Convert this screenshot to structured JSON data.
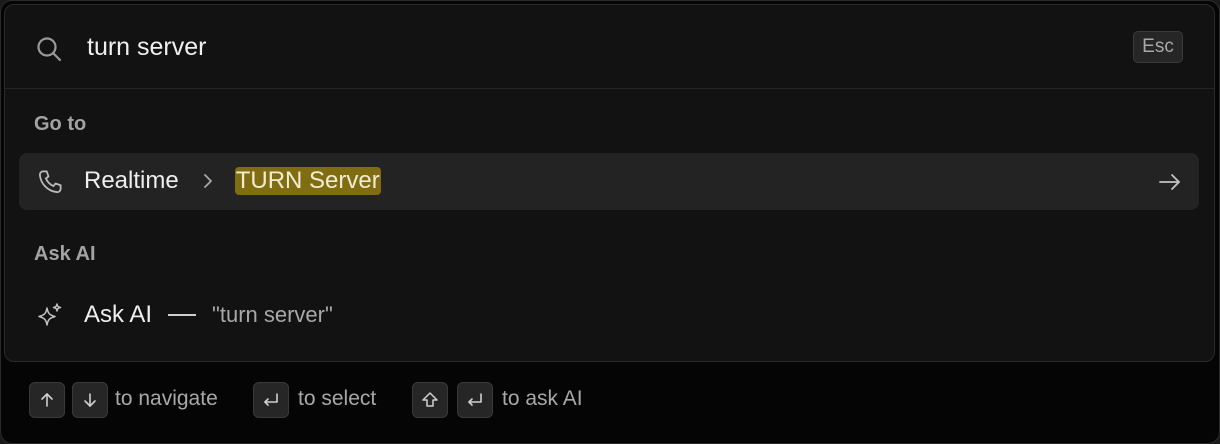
{
  "search": {
    "value": "turn server",
    "esc_label": "Esc"
  },
  "sections": {
    "goto_label": "Go to",
    "askai_label": "Ask AI"
  },
  "goto_result": {
    "parent": "Realtime",
    "match": "TURN Server",
    "icon": "phone-icon"
  },
  "ask_ai": {
    "label": "Ask AI",
    "query": "\"turn server\"",
    "icon": "sparkle-icon"
  },
  "footer": {
    "navigate_label": "to navigate",
    "select_label": "to select",
    "ask_label": "to ask AI"
  },
  "colors": {
    "highlight": "#806d12",
    "selected_row": "#232323",
    "background": "#121212"
  }
}
